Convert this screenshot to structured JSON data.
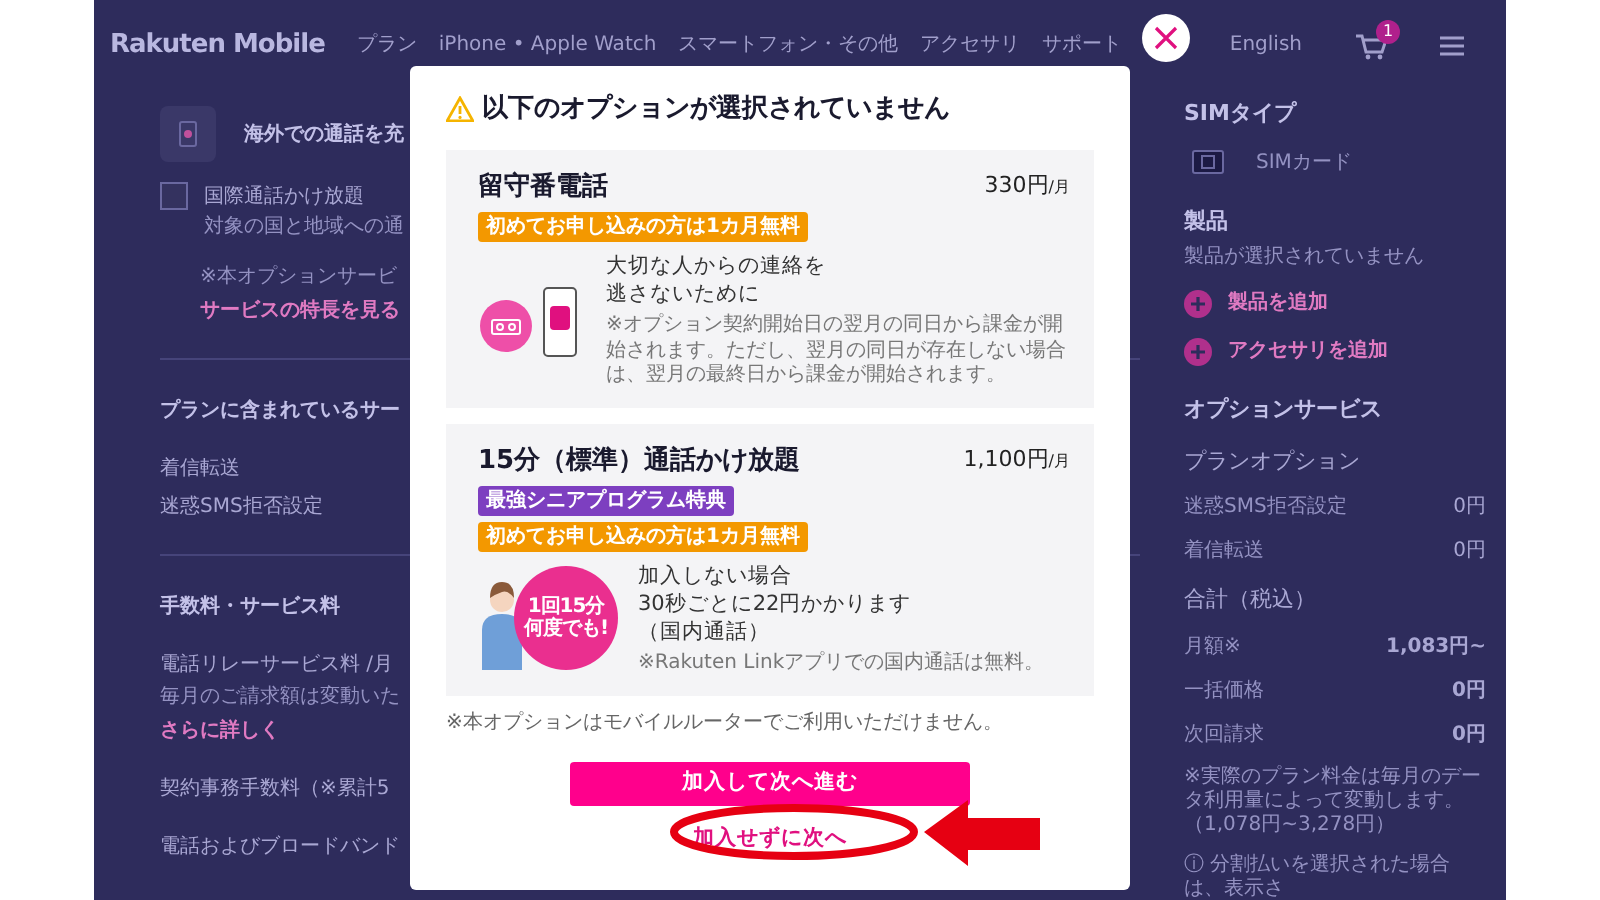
{
  "header": {
    "logo": "Rakuten Mobile",
    "nav": [
      "プラン",
      "iPhone • Apple Watch",
      "スマートフォン・その他",
      "アクセサリ",
      "サポート"
    ],
    "language": "English",
    "cart_count": "1"
  },
  "background": {
    "left": [
      {
        "kind": "feature",
        "text": "海外での通話を充"
      },
      {
        "kind": "checkbox",
        "label": "国際通話かけ放題",
        "sub": "対象の国と地域への通",
        "checked": false
      },
      {
        "kind": "note",
        "text": "※本オプションサービ"
      },
      {
        "kind": "link",
        "text": "サービスの特長を見る"
      },
      {
        "kind": "divider"
      },
      {
        "kind": "heading",
        "text": "プランに含まれているサー"
      },
      {
        "kind": "text",
        "text": "着信転送"
      },
      {
        "kind": "text",
        "text": "迷惑SMS拒否設定"
      },
      {
        "kind": "divider"
      },
      {
        "kind": "heading",
        "text": "手数料・サービス料"
      },
      {
        "kind": "text",
        "text": "電話リレーサービス料 /月"
      },
      {
        "kind": "note",
        "text": "毎月のご請求額は変動いた"
      },
      {
        "kind": "link",
        "text": "さらに詳しく"
      },
      {
        "kind": "text",
        "text": "契約事務手数料（※累計5"
      },
      {
        "kind": "text",
        "text": "電話およびブロードバンド"
      }
    ],
    "right": [
      {
        "kind": "heading",
        "text": "SIMタイプ"
      },
      {
        "kind": "sim",
        "text": "SIMカード"
      },
      {
        "kind": "heading",
        "text": "製品"
      },
      {
        "kind": "note",
        "text": "製品が選択されていません"
      },
      {
        "kind": "add",
        "text": "製品を追加"
      },
      {
        "kind": "add",
        "text": "アクセサリを追加"
      },
      {
        "kind": "heading",
        "text": "オプションサービス"
      },
      {
        "kind": "subheading",
        "text": "プランオプション"
      },
      {
        "kind": "price",
        "label": "迷惑SMS拒否設定",
        "value": "0円",
        "bold": false
      },
      {
        "kind": "price",
        "label": "着信転送",
        "value": "0円",
        "bold": false
      },
      {
        "kind": "subheading",
        "text": "合計（税込）"
      },
      {
        "kind": "price",
        "label": "月額※",
        "value": "1,083円~",
        "bold": true
      },
      {
        "kind": "price",
        "label": "一括価格",
        "value": "0円",
        "bold": true
      },
      {
        "kind": "price",
        "label": "次回請求",
        "value": "0円",
        "bold": true
      },
      {
        "kind": "note",
        "text": "※実際のプラン料金は毎月のデータ利用量によって変動します。（1,078円~3,278円）"
      },
      {
        "kind": "note",
        "text": "ⓘ 分割払いを選択された場合は、表示さ"
      }
    ]
  },
  "modal": {
    "title": "以下のオプションが選択されていません",
    "options": [
      {
        "name": "留守番電話",
        "price": "330円",
        "unit": "/月",
        "badges": [
          {
            "text": "初めてお申し込みの方は1カ月無料",
            "color": "#f39800"
          }
        ],
        "kind": "voicemail",
        "lines": [
          "大切な人からの連絡を",
          "逃さないために"
        ],
        "note": "※オプション契約開始日の翌月の同日から課金が開始されます。ただし、翌月の同日が存在しない場合は、翌月の最終日から課金が開始されます。"
      },
      {
        "name": "15分（標準）通話かけ放題",
        "price": "1,100円",
        "unit": "/月",
        "badges": [
          {
            "text": "最強シニアプログラム特典",
            "color": "#7d3fc0"
          },
          {
            "text": "初めてお申し込みの方は1カ月無料",
            "color": "#f39800"
          }
        ],
        "kind": "person",
        "bubble": [
          "1回15分",
          "何度でも!"
        ],
        "lines": [
          "加入しない場合",
          "30秒ごとに22円かかります",
          "（国内通話）"
        ],
        "note": "※Rakuten Linkアプリでの国内通話は無料。"
      }
    ],
    "footnote": "※本オプションはモバイルルーターでご利用いただけません。",
    "primary_button": "加入して次へ進む",
    "skip_link": "加入せずに次へ"
  }
}
